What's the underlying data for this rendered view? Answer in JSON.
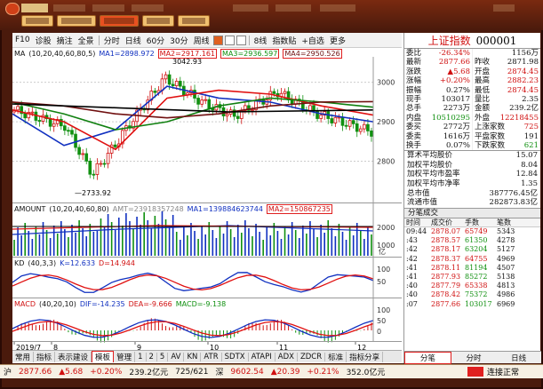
{
  "topbar": {
    "buttons": [
      "",
      "",
      "",
      "",
      "",
      ""
    ],
    "active_button": 3
  },
  "toolbar": {
    "items": [
      "F10",
      "诊股",
      "摘注",
      "全景",
      "分时",
      "日线",
      "60分",
      "30分",
      "周线",
      "",
      "8线",
      "指数贴",
      "+自选",
      "更多"
    ]
  },
  "main_legend": {
    "title": "MA",
    "params": "(10,20,40,60,80,5)",
    "ma1": "MA1=2898.972",
    "ma2": "MA2=2917.161",
    "ma3": "MA3=2936.597",
    "ma4": "MA4=2950.526"
  },
  "price_labels": {
    "high": "3042.93",
    "low": "2733.92"
  },
  "price_axis": [
    "3000",
    "2900",
    "2800"
  ],
  "amount_legend": {
    "title": "AMOUNT",
    "params": "(10,20,40,60,80)",
    "amt": "AMT=23918357248",
    "ma1": "MA1=139884623744",
    "ma2": "MA2=150867235"
  },
  "amount_axis": [
    "2000",
    "1000"
  ],
  "amount_unit": "亿",
  "kd_legend": {
    "title": "KD",
    "params": "(40,3,3)",
    "k": "K=12.633",
    "d": "D=14.944"
  },
  "kd_axis": [
    "100",
    "50"
  ],
  "macd_legend": {
    "title": "MACD",
    "params": "(40,20,10)",
    "dif": "DIF=-14.235",
    "dea": "DEA=-9.666",
    "macd": "MACD=-9.138"
  },
  "macd_axis": [
    "100",
    "50",
    "0"
  ],
  "x_axis": [
    "2019/7",
    "8",
    "9",
    "10",
    "11",
    "12"
  ],
  "bottom_tabs": [
    "常用",
    "指标",
    "表示建设",
    "模板",
    "管理",
    "1",
    "2",
    "5",
    "AV",
    "KN",
    "ATR",
    "SDTX",
    "ATAPI",
    "ADX",
    "ZDCR",
    "标准",
    "指标分享"
  ],
  "bottom_tab_active": "模板",
  "quote": {
    "name": "上证指数",
    "code": "000001",
    "rows": [
      [
        [
          "委比",
          "-26.34%",
          "red"
        ],
        [
          "",
          "1156万",
          ""
        ]
      ],
      [
        [
          "最新",
          "2877.66",
          "red"
        ],
        [
          "昨收",
          "2871.98",
          ""
        ]
      ],
      [
        [
          "涨跌",
          "▲5.68",
          "red"
        ],
        [
          "开盘",
          "2874.45",
          "red"
        ]
      ],
      [
        [
          "涨幅",
          "+0.20%",
          "red"
        ],
        [
          "最高",
          "2882.23",
          "red"
        ]
      ],
      [
        [
          "振幅",
          "0.27%",
          ""
        ],
        [
          "最低",
          "2874.45",
          "red"
        ]
      ],
      [
        [
          "现手",
          "103017",
          ""
        ],
        [
          "量比",
          "2.35",
          ""
        ]
      ],
      [
        [
          "总手",
          "2273万",
          ""
        ],
        [
          "金额",
          "239.2亿",
          ""
        ]
      ],
      [
        [
          "内盘",
          "10510295",
          "green"
        ],
        [
          "外盘",
          "12218455",
          "red"
        ]
      ],
      [
        [
          "委买",
          "2772万",
          ""
        ],
        [
          "上涨家数",
          "725",
          "red"
        ]
      ],
      [
        [
          "委卖",
          "1616万",
          ""
        ],
        [
          "平盘家数",
          "191",
          ""
        ]
      ],
      [
        [
          "换手",
          "0.07%",
          ""
        ],
        [
          "下跌家数",
          "621",
          "green"
        ]
      ]
    ]
  },
  "stats": [
    [
      "算术平均股价",
      "15.07"
    ],
    [
      "加权平均股价",
      "8.04"
    ],
    [
      "加权平均市盈率",
      "12.84"
    ],
    [
      "加权平均市净率",
      "1.35"
    ],
    [
      "总市值",
      "387776.45亿"
    ],
    [
      "流通市值",
      "282873.83亿"
    ]
  ],
  "trades": {
    "title": "分笔成交",
    "headers": [
      "时间",
      "成交价",
      "手数",
      "笔数"
    ],
    "rows": [
      [
        "09:44",
        "2878.07",
        "65749",
        "5343"
      ],
      [
        ":43",
        "2878.57",
        "61350",
        "4278"
      ],
      [
        ":42",
        "2878.17",
        "63204",
        "5127"
      ],
      [
        ":42",
        "2878.37",
        "64755",
        "4969"
      ],
      [
        ":41",
        "2878.11",
        "81194",
        "4507"
      ],
      [
        ":41",
        "2877.93",
        "85272",
        "5138"
      ],
      [
        ":40",
        "2877.79",
        "65338",
        "4813"
      ],
      [
        ":40",
        "2878.42",
        "75372",
        "4986"
      ],
      [
        ":07",
        "2877.66",
        "103017",
        "6969"
      ]
    ]
  },
  "right_tabs": [
    "分笔",
    "分时",
    "日线"
  ],
  "right_tab_active": "分笔",
  "status": {
    "index": "沪",
    "price": "2877.66",
    "change": "▲5.68",
    "pct": "+0.20%",
    "amount": "239.2亿元",
    "updown": "725/621",
    "sz_name": "深",
    "sz_price": "9602.54",
    "sz_change": "▲20.39",
    "sz_pct": "+0.21%",
    "sz_amount": "352.0亿元",
    "sz_updown": "1075/890",
    "conn": "连接正常"
  },
  "colors": {
    "up": "#d01010",
    "down": "#109010",
    "ma1": "#1030c0",
    "ma2": "#e01010",
    "ma3": "#108010",
    "ma4": "#701010",
    "ma5": "#000000"
  },
  "chart_data": {
    "type": "line",
    "title": "上证指数 日线",
    "x": [
      "2019/7",
      "8",
      "9",
      "10",
      "11",
      "12"
    ],
    "series": [
      {
        "name": "MA1",
        "values": [
          2920,
          2840,
          2880,
          2990,
          2960,
          2950,
          2920,
          2900
        ]
      },
      {
        "name": "MA2",
        "values": [
          2930,
          2900,
          2830,
          2960,
          2980,
          2970,
          2940,
          2917
        ]
      },
      {
        "name": "MA3",
        "values": [
          2950,
          2920,
          2880,
          2900,
          2940,
          2960,
          2950,
          2937
        ]
      },
      {
        "name": "MA4",
        "values": [
          2950,
          2940,
          2920,
          2910,
          2920,
          2940,
          2950,
          2951
        ]
      }
    ],
    "ylim": [
      2700,
      3060
    ]
  }
}
